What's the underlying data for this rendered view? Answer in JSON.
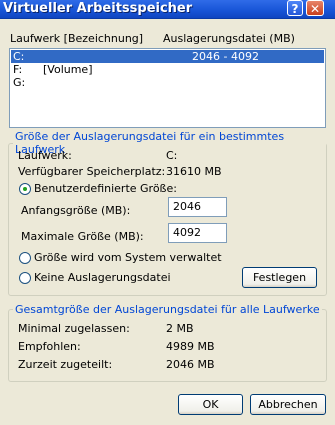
{
  "window": {
    "title": "Virtueller Arbeitsspeicher",
    "help_glyph": "?",
    "close_glyph": "✕"
  },
  "drives": {
    "header_drive": "Laufwerk [Bezeichnung]",
    "header_paging": "Auslagerungsdatei (MB)",
    "rows": [
      {
        "drive": "C:",
        "label": "",
        "size": "2046 - 4092",
        "selected": true
      },
      {
        "drive": "F:",
        "label": "[Volume]",
        "size": "",
        "selected": false
      },
      {
        "drive": "G:",
        "label": "",
        "size": "",
        "selected": false
      }
    ]
  },
  "selected_drive": {
    "group_title": "Größe der Auslagerungsdatei für ein bestimmtes Laufwerk",
    "drive_label": "Laufwerk:",
    "drive_value": "C:",
    "space_label": "Verfügbarer Speicherplatz:",
    "space_value": "31610 MB",
    "custom_label": "Benutzerdefinierte Größe:",
    "initial_label": "Anfangsgröße (MB):",
    "initial_value": "2046",
    "max_label": "Maximale Größe (MB):",
    "max_value": "4092",
    "system_label": "Größe wird vom System verwaltet",
    "none_label": "Keine Auslagerungsdatei",
    "set_button": "Festlegen",
    "selected_option": "custom"
  },
  "totals": {
    "group_title": "Gesamtgröße der Auslagerungsdatei für alle Laufwerke",
    "min_label": "Minimal zugelassen:",
    "min_value": "2 MB",
    "rec_label": "Empfohlen:",
    "rec_value": "4989 MB",
    "cur_label": "Zurzeit zugeteilt:",
    "cur_value": "2046 MB"
  },
  "buttons": {
    "ok": "OK",
    "cancel": "Abbrechen"
  }
}
